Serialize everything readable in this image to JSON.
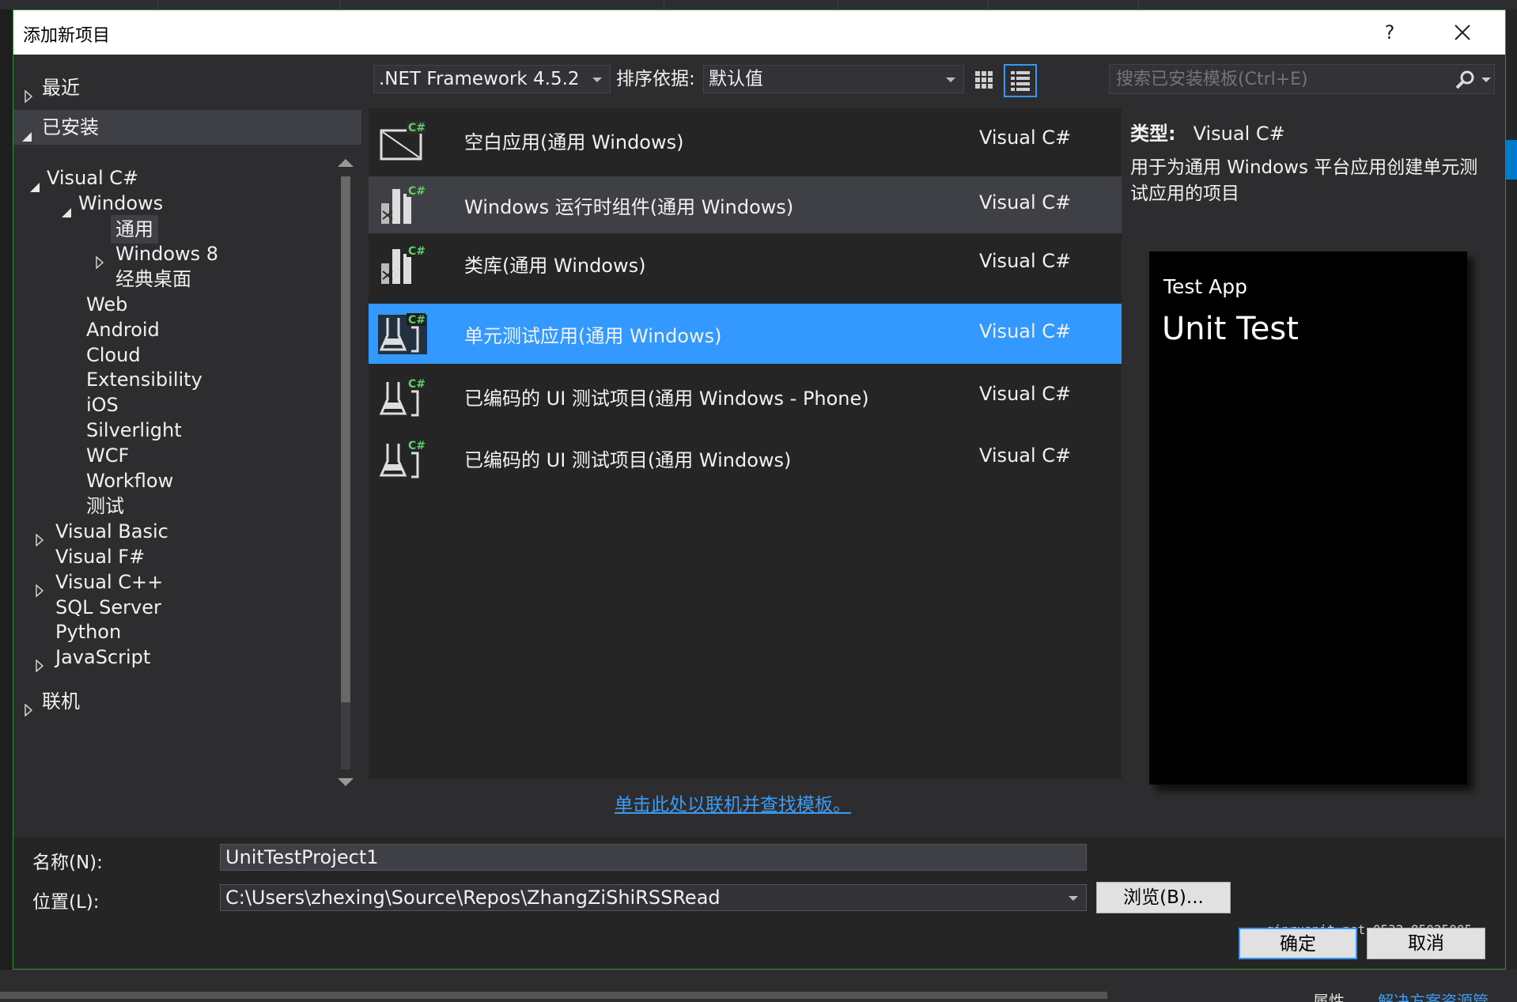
{
  "dialog": {
    "title": "添加新项目",
    "help_label": "?",
    "close_label": "×"
  },
  "nav": {
    "recent": "最近",
    "installed": "已安装",
    "tree": [
      {
        "label": "Visual C#",
        "level": 0,
        "state": "expanded"
      },
      {
        "label": "Windows",
        "level": 1,
        "state": "expanded"
      },
      {
        "label": "通用",
        "level": 2,
        "state": "selected"
      },
      {
        "label": "Windows 8",
        "level": 2,
        "state": "collapsed"
      },
      {
        "label": "经典桌面",
        "level": 2,
        "state": "leaf"
      },
      {
        "label": "Web",
        "level": 1,
        "state": "leaf"
      },
      {
        "label": "Android",
        "level": 1,
        "state": "leaf"
      },
      {
        "label": "Cloud",
        "level": 1,
        "state": "leaf"
      },
      {
        "label": "Extensibility",
        "level": 1,
        "state": "leaf"
      },
      {
        "label": "iOS",
        "level": 1,
        "state": "leaf"
      },
      {
        "label": "Silverlight",
        "level": 1,
        "state": "leaf"
      },
      {
        "label": "WCF",
        "level": 1,
        "state": "leaf"
      },
      {
        "label": "Workflow",
        "level": 1,
        "state": "leaf"
      },
      {
        "label": "测试",
        "level": 1,
        "state": "leaf"
      },
      {
        "label": "Visual Basic",
        "level": 0,
        "state": "collapsed"
      },
      {
        "label": "Visual F#",
        "level": 0,
        "state": "leaf"
      },
      {
        "label": "Visual C++",
        "level": 0,
        "state": "collapsed"
      },
      {
        "label": "SQL Server",
        "level": 0,
        "state": "leaf"
      },
      {
        "label": "Python",
        "level": 0,
        "state": "leaf"
      },
      {
        "label": "JavaScript",
        "level": 0,
        "state": "collapsed"
      }
    ],
    "online": "联机"
  },
  "toolbar": {
    "framework": ".NET Framework 4.5.2",
    "sort_label": "排序依据:",
    "sort_value": "默认值",
    "search_placeholder": "搜索已安装模板(Ctrl+E)"
  },
  "templates": [
    {
      "name": "空白应用(通用 Windows)",
      "lang": "Visual C#",
      "icon": "blank-app-icon",
      "state": "normal"
    },
    {
      "name": "Windows 运行时组件(通用 Windows)",
      "lang": "Visual C#",
      "icon": "runtime-component-icon",
      "state": "hover"
    },
    {
      "name": "类库(通用 Windows)",
      "lang": "Visual C#",
      "icon": "class-library-icon",
      "state": "normal"
    },
    {
      "name": "单元测试应用(通用 Windows)",
      "lang": "Visual C#",
      "icon": "unit-test-icon",
      "state": "selected"
    },
    {
      "name": "已编码的 UI 测试项目(通用 Windows - Phone)",
      "lang": "Visual C#",
      "icon": "coded-ui-test-icon",
      "state": "normal"
    },
    {
      "name": "已编码的 UI 测试项目(通用 Windows)",
      "lang": "Visual C#",
      "icon": "coded-ui-test-icon",
      "state": "normal"
    }
  ],
  "online_link": "单击此处以联机并查找模板。",
  "info": {
    "type_label": "类型:",
    "type_value": "Visual C#",
    "description": "用于为通用 Windows 平台应用创建单元测试应用的项目",
    "preview_title": "Test App",
    "preview_subtitle": "Unit Test"
  },
  "form": {
    "name_label": "名称(N):",
    "name_value": "UnitTestProject1",
    "location_label": "位置(L):",
    "location_value": "C:\\Users\\zhexing\\Source\\Repos\\ZhangZiShiRSSRead",
    "browse_label": "浏览(B)...",
    "ok_label": "确定",
    "cancel_label": "取消"
  },
  "watermark": "qinruanit.net 0532-85025005",
  "background": {
    "bottom_tab_properties": "属性",
    "bottom_tab_solution": "解决方案资源管"
  },
  "colors": {
    "accent": "#3399ff",
    "dialog_bg": "#2d2d30",
    "list_bg": "#252526",
    "link": "#3c9cf5",
    "csharp_badge": "#5fd068"
  }
}
